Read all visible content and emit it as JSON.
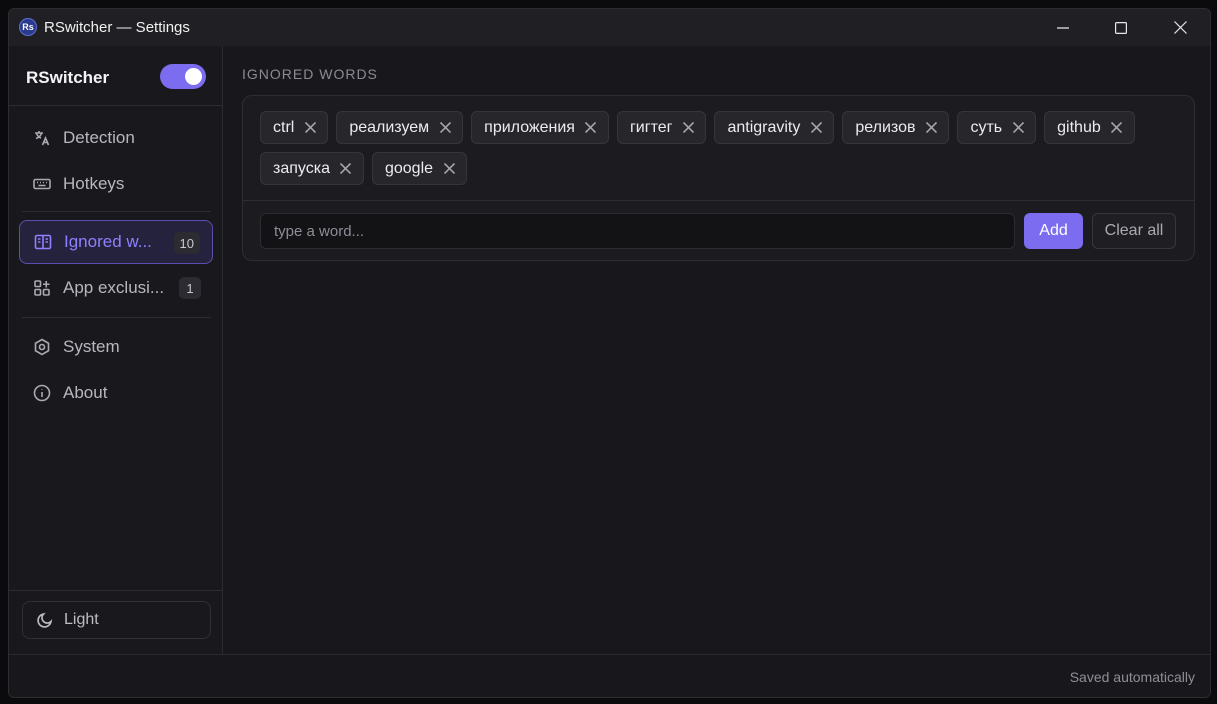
{
  "window": {
    "title": "RSwitcher — Settings",
    "icon_text": "Rs"
  },
  "sidebar": {
    "brand": "RSwitcher",
    "enabled": true,
    "items": [
      {
        "label": "Detection",
        "icon": "translate-icon"
      },
      {
        "label": "Hotkeys",
        "icon": "keyboard-icon"
      },
      {
        "label": "Ignored w...",
        "icon": "book-icon",
        "count": "10",
        "active": true
      },
      {
        "label": "App exclusi...",
        "icon": "apps-icon",
        "count": "1"
      },
      {
        "label": "System",
        "icon": "hexagon-icon"
      },
      {
        "label": "About",
        "icon": "info-icon"
      }
    ],
    "theme_label": "Light"
  },
  "main": {
    "section_title": "IGNORED WORDS",
    "words": [
      "ctrl",
      "реализуем",
      "приложения",
      "гигтег",
      "antigravity",
      "релизов",
      "суть",
      "github",
      "запуска",
      "google"
    ],
    "input_placeholder": "type a word...",
    "add_label": "Add",
    "clear_label": "Clear all"
  },
  "footer": {
    "status": "Saved automatically"
  },
  "colors": {
    "accent": "#7c6cf0",
    "background": "#18181c"
  }
}
